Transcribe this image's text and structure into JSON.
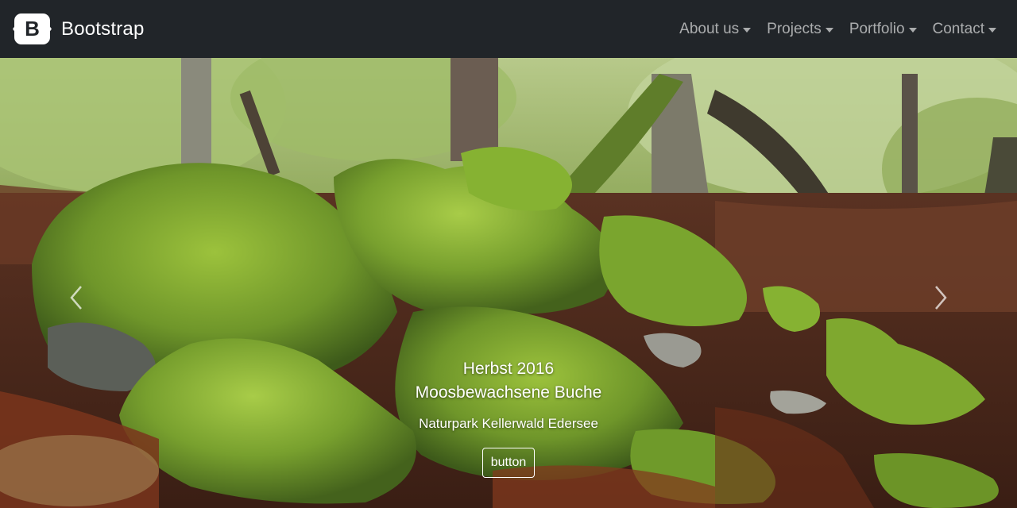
{
  "navbar": {
    "brand_logo_letter": "B",
    "brand_text": "Bootstrap",
    "items": [
      {
        "label": "About us"
      },
      {
        "label": "Projects"
      },
      {
        "label": "Portfolio"
      },
      {
        "label": "Contact"
      }
    ]
  },
  "carousel": {
    "caption": {
      "title": "Herbst 2016",
      "subtitle": "Moosbewachsene Buche",
      "text": "Naturpark Kellerwald Edersee",
      "button_label": "button"
    },
    "prev_icon": "chevron-left-icon",
    "next_icon": "chevron-right-icon"
  },
  "colors": {
    "navbar_bg": "#212529",
    "moss": "#7fa52a",
    "leaves": "#8a3a1c"
  }
}
